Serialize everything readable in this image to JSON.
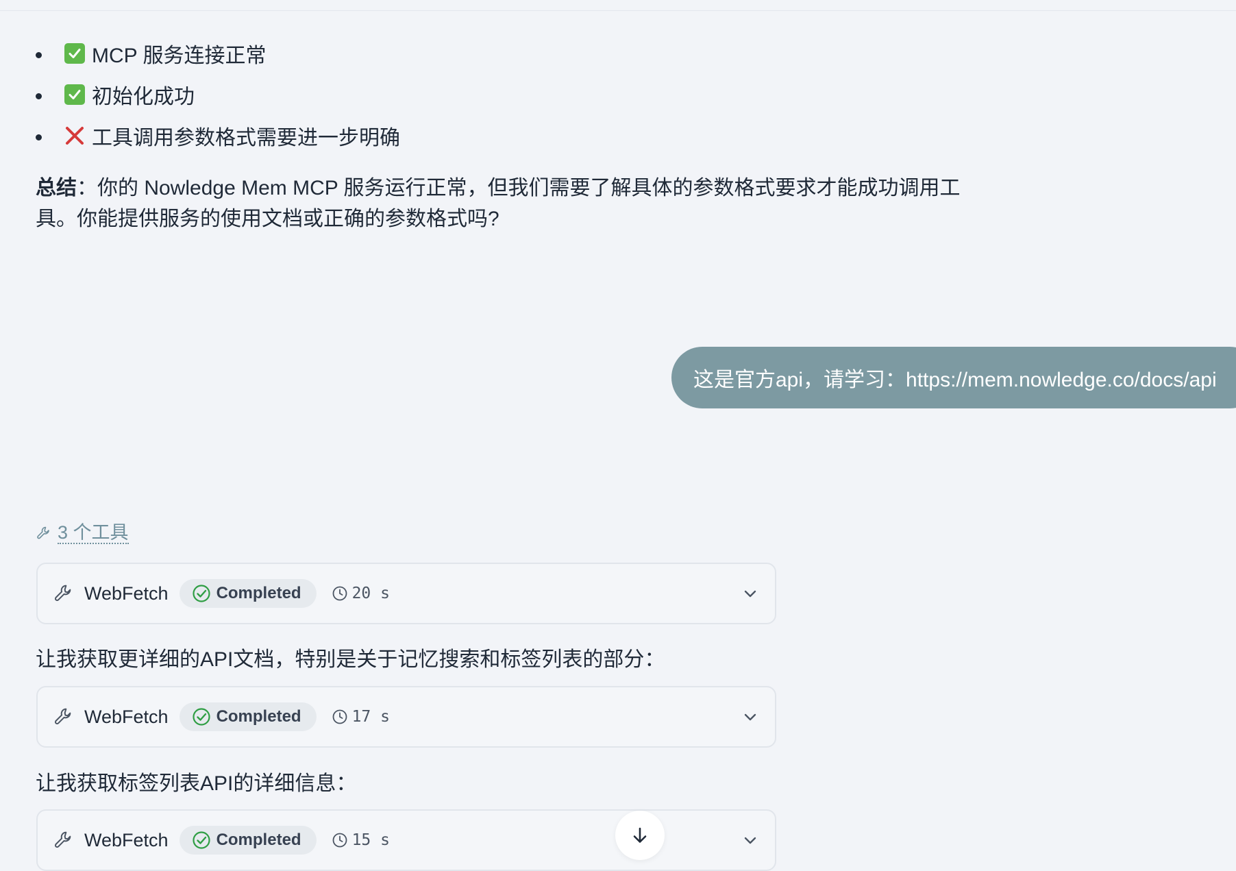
{
  "status_list": [
    {
      "icon": "check-box-icon",
      "text": "MCP 服务连接正常"
    },
    {
      "icon": "check-box-icon",
      "text": "初始化成功"
    },
    {
      "icon": "cross-mark-icon",
      "text": "工具调用参数格式需要进一步明确"
    }
  ],
  "summary": {
    "label": "总结",
    "separator": "：",
    "text": "你的 Nowledge Mem MCP 服务运行正常，但我们需要了解具体的参数格式要求才能成功调用工具。你能提供服务的使用文档或正确的参数格式吗?"
  },
  "user_message": "这是官方api，请学习：https://mem.nowledge.co/docs/api",
  "tools_header": "3 个工具",
  "tool_calls": [
    {
      "name": "WebFetch",
      "status": "Completed",
      "duration": "20 s"
    },
    {
      "name": "WebFetch",
      "status": "Completed",
      "duration": "17 s"
    },
    {
      "name": "WebFetch",
      "status": "Completed",
      "duration": "15 s"
    }
  ],
  "steps": [
    "让我获取更详细的API文档，特别是关于记忆搜索和标签列表的部分：",
    "让我获取标签列表API的详细信息："
  ],
  "colors": {
    "background": "#f2f4f8",
    "user_bubble": "#7d9aa2",
    "check_green": "#5fb84b",
    "cross_red": "#d63a3a",
    "completed_green": "#2f9e44",
    "tools_link": "#6f8f9c"
  }
}
